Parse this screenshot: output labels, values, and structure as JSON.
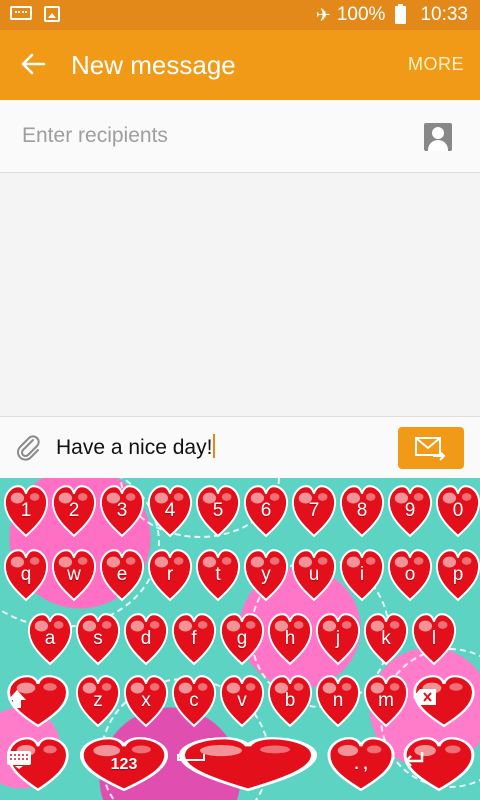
{
  "status_bar": {
    "battery_percent": "100%",
    "time": "10:33",
    "icons": [
      "keyboard-icon",
      "image-icon",
      "airplane-mode-icon",
      "battery-icon"
    ]
  },
  "app_bar": {
    "title": "New message",
    "more_label": "MORE",
    "background_color": "#f09a18"
  },
  "recipients": {
    "placeholder": "Enter recipients"
  },
  "compose": {
    "text": "Have a nice day!"
  },
  "keyboard": {
    "row_numbers": [
      "1",
      "2",
      "3",
      "4",
      "5",
      "6",
      "7",
      "8",
      "9",
      "0"
    ],
    "row_top": [
      "q",
      "w",
      "e",
      "r",
      "t",
      "y",
      "u",
      "i",
      "o",
      "p"
    ],
    "row_middle": [
      "a",
      "s",
      "d",
      "f",
      "g",
      "h",
      "j",
      "k",
      "l"
    ],
    "row_bottom": [
      "z",
      "x",
      "c",
      "v",
      "b",
      "n",
      "m"
    ],
    "symbols_label": "123",
    "punctuation_label": ". ,",
    "key_color": "#e3101c"
  }
}
